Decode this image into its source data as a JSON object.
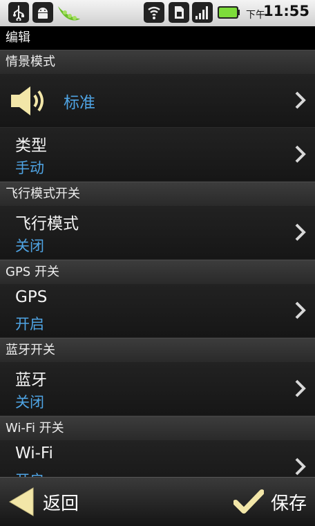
{
  "status_bar": {
    "ampm": "下午",
    "time": "11:55",
    "icons": [
      "usb-icon",
      "android-debug-icon",
      "peapod-app-icon",
      "wifi-icon",
      "sim-card-icon",
      "signal-icon",
      "battery-icon"
    ]
  },
  "title": "编辑",
  "profile_section": {
    "header": "情景模式",
    "profile_name": "标准",
    "type_label": "类型",
    "type_value": "手动"
  },
  "airplane": {
    "header": "飞行模式开关",
    "label": "飞行模式",
    "value": "关闭"
  },
  "gps": {
    "header": "GPS 开关",
    "label": "GPS",
    "value": "开启"
  },
  "bluetooth": {
    "header": "蓝牙开关",
    "label": "蓝牙",
    "value": "关闭"
  },
  "wifi": {
    "header": "Wi-Fi 开关",
    "label": "Wi-Fi",
    "value": "开启"
  },
  "bottom_bar": {
    "back_label": "返回",
    "save_label": "保存"
  },
  "colors": {
    "accent_blue": "#4fa4e4",
    "speaker_yellow": "#f2e6a8"
  }
}
